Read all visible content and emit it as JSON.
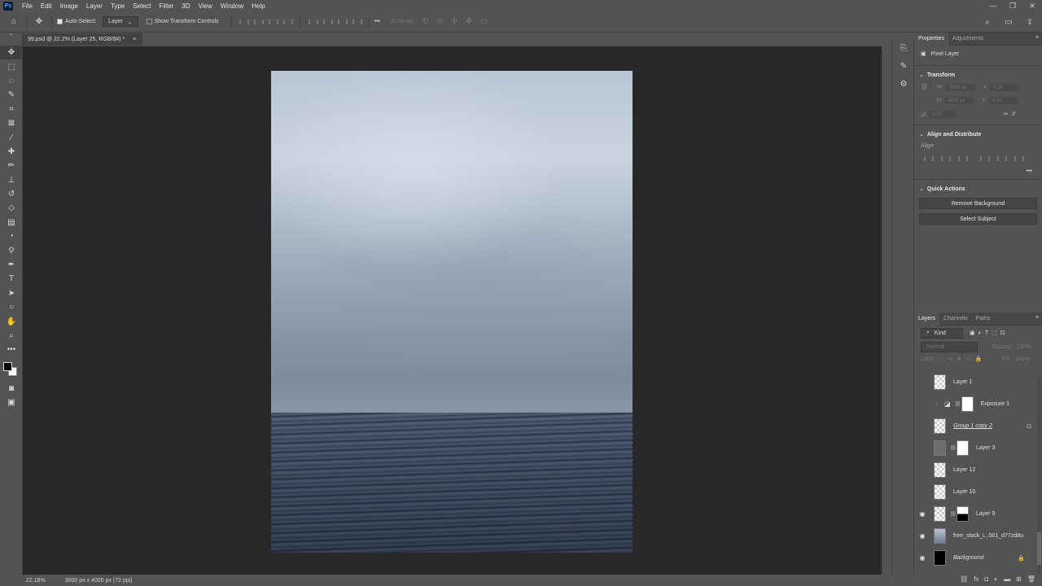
{
  "menubar": {
    "logo": "Ps",
    "items": [
      "File",
      "Edit",
      "Image",
      "Layer",
      "Type",
      "Select",
      "Filter",
      "3D",
      "View",
      "Window",
      "Help"
    ],
    "window_controls": [
      "—",
      "❐",
      "✕"
    ]
  },
  "options": {
    "auto_select_label": "Auto-Select:",
    "auto_select_value": "Layer",
    "show_transform_label": "Show Transform Controls",
    "more": "•••",
    "mode_3d": "3D Mode:"
  },
  "document_tab": {
    "title": "99.psd @ 22.2% (Layer 25, RGB/8#) *",
    "close": "×"
  },
  "status": {
    "zoom": "22.18%",
    "doc_info": "3000 px x 4000 px (72 ppi)"
  },
  "properties": {
    "tabs": [
      "Properties",
      "Adjustments"
    ],
    "layer_kind": "Pixel Layer",
    "transform_title": "Transform",
    "w_label": "W",
    "h_label": "H",
    "x_label": "X",
    "y_label": "Y",
    "w_value": "3000 px",
    "h_value": "4000 px",
    "x_value": "0 px",
    "y_value": "0 px",
    "angle_value": "0.00°",
    "align_title": "Align and Distribute",
    "align_label": "Align:",
    "more": "•••",
    "quick_actions_title": "Quick Actions",
    "remove_bg": "Remove Background",
    "select_subject": "Select Subject"
  },
  "layers_panel": {
    "tabs": [
      "Layers",
      "Channels",
      "Paths"
    ],
    "kind_label": "Kind",
    "blend_mode": "Normal",
    "opacity_label": "Opacity:",
    "opacity_value": "100%",
    "lock_label": "Lock:",
    "fill_label": "Fill:",
    "fill_value": "100%",
    "layers": [
      {
        "name": "Layer 1"
      },
      {
        "name": "Exposure 1"
      },
      {
        "name": "Group 1 copy 2"
      },
      {
        "name": "Layer 3"
      },
      {
        "name": "Layer 12"
      },
      {
        "name": "Layer 10"
      },
      {
        "name": "Layer 9"
      },
      {
        "name": "free_stock_i...001_d77zd8u"
      },
      {
        "name": "Background"
      }
    ]
  }
}
